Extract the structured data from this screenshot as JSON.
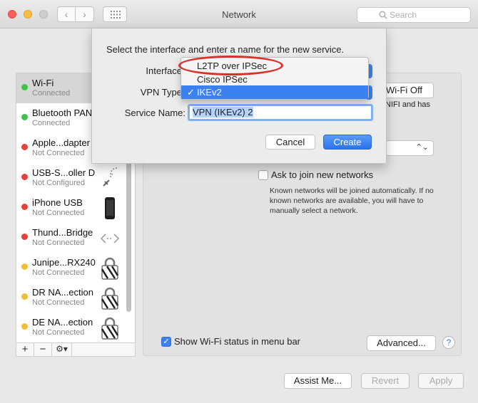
{
  "window": {
    "title": "Network",
    "search_placeholder": "Search",
    "back_glyph": "‹",
    "forward_glyph": "›"
  },
  "services": [
    {
      "name": "Wi-Fi",
      "status": "Connected",
      "color": "green",
      "selected": true,
      "icon": ""
    },
    {
      "name": "Bluetooth PAN",
      "status": "Connected",
      "color": "green",
      "selected": false,
      "icon": ""
    },
    {
      "name": "Apple...dapter",
      "status": "Not Connected",
      "color": "red",
      "selected": false,
      "icon": ""
    },
    {
      "name": "USB-S...oller D",
      "status": "Not Configured",
      "color": "red",
      "selected": false,
      "icon": "phone-signal-icon"
    },
    {
      "name": "iPhone USB",
      "status": "Not Connected",
      "color": "red",
      "selected": false,
      "icon": "iphone-icon"
    },
    {
      "name": "Thund...Bridge",
      "status": "Not Connected",
      "color": "red",
      "selected": false,
      "icon": "bridge-arrows-icon"
    },
    {
      "name": "Junipe...RX240",
      "status": "Not Connected",
      "color": "yellow",
      "selected": false,
      "icon": "vpn-lock-icon"
    },
    {
      "name": "DR NA...ection",
      "status": "Not Connected",
      "color": "yellow",
      "selected": false,
      "icon": "vpn-lock-icon"
    },
    {
      "name": "DE NA...ection",
      "status": "Not Connected",
      "color": "yellow",
      "selected": false,
      "icon": "vpn-lock-icon"
    }
  ],
  "sidebar_tools": {
    "add": "+",
    "remove": "−",
    "gear": "⚙▾"
  },
  "panel": {
    "wifi_off_label": "Wi-Fi Off",
    "wifi_fragment": "NIFI and has",
    "ask_join_label": "Ask to join new networks",
    "ask_join_desc": "Known networks will be joined automatically. If no known networks are available, you will have to manually select a network.",
    "show_wifi_status_label": "Show Wi-Fi status in menu bar",
    "advanced_label": "Advanced...",
    "help_label": "?"
  },
  "footer": {
    "assist_label": "Assist Me...",
    "revert_label": "Revert",
    "apply_label": "Apply"
  },
  "sheet": {
    "title": "Select the interface and enter a name for the new service.",
    "interface_label": "Interface",
    "vpn_type_label": "VPN Type",
    "service_name_label": "Service Name:",
    "service_name_value": "VPN (IKEv2) 2",
    "cancel_label": "Cancel",
    "create_label": "Create"
  },
  "dropdown": {
    "items": [
      {
        "label": "L2TP over IPSec",
        "selected": false
      },
      {
        "label": "Cisco IPSec",
        "selected": false
      },
      {
        "label": "IKEv2",
        "selected": true
      }
    ],
    "check_glyph": "✓"
  },
  "colors": {
    "accent": "#3b82f0",
    "annotation": "#d9302a"
  }
}
